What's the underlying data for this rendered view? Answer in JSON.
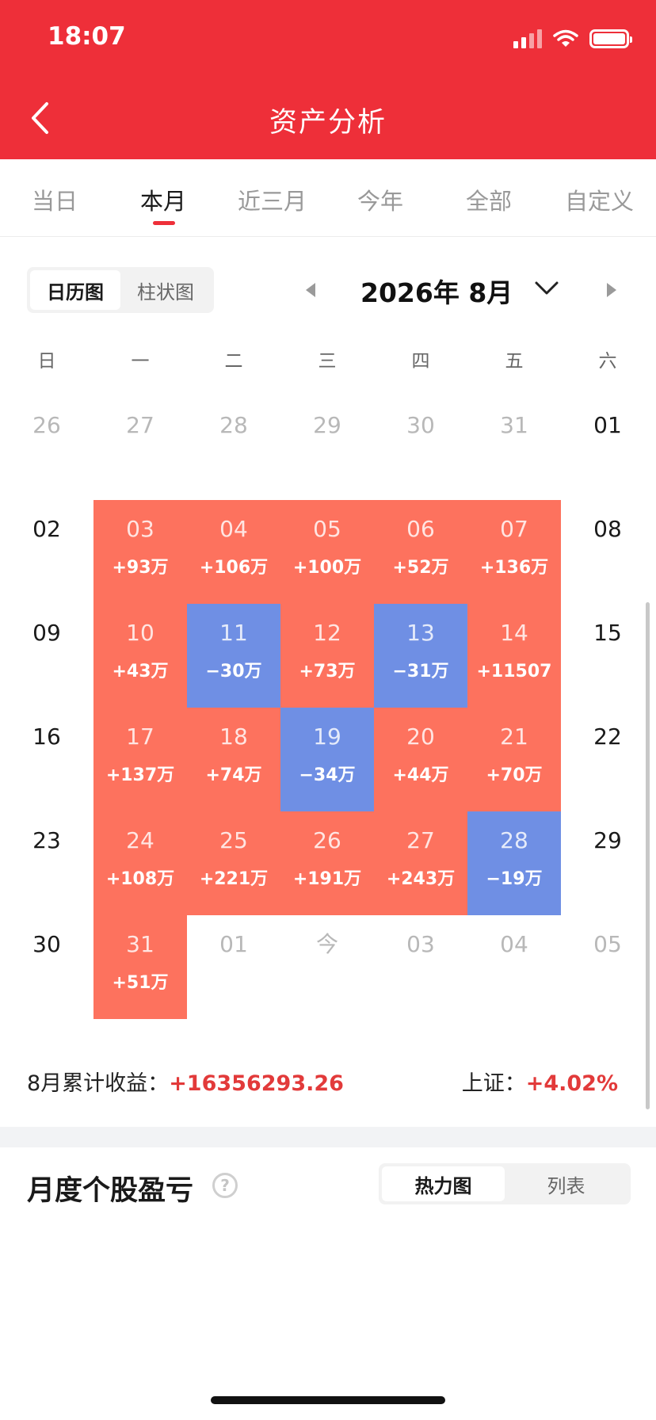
{
  "status_bar": {
    "time": "18:07",
    "signal_bars": 2,
    "battery_level": 1.0
  },
  "header": {
    "title": "资产分析",
    "back_icon": "chevron-left-icon"
  },
  "period_tabs": [
    {
      "label": "当日",
      "active": false
    },
    {
      "label": "本月",
      "active": true
    },
    {
      "label": "近三月",
      "active": false
    },
    {
      "label": "今年",
      "active": false
    },
    {
      "label": "全部",
      "active": false
    },
    {
      "label": "自定义",
      "active": false
    }
  ],
  "view_toggle": [
    {
      "label": "日历图",
      "active": true
    },
    {
      "label": "柱状图",
      "active": false
    }
  ],
  "month_nav": {
    "label": "2026年 8月",
    "prev_icon": "triangle-left-icon",
    "dropdown_icon": "chevron-down-icon",
    "next_icon": "triangle-right-icon"
  },
  "weekdays": [
    "日",
    "一",
    "二",
    "三",
    "四",
    "五",
    "六"
  ],
  "calendar": [
    [
      {
        "d": "26",
        "s": "muted"
      },
      {
        "d": "27",
        "s": "muted"
      },
      {
        "d": "28",
        "s": "muted"
      },
      {
        "d": "29",
        "s": "muted"
      },
      {
        "d": "30",
        "s": "muted"
      },
      {
        "d": "31",
        "s": "muted"
      },
      {
        "d": "01",
        "s": "plain"
      }
    ],
    [
      {
        "d": "02",
        "s": "plain"
      },
      {
        "d": "03",
        "v": "+93万",
        "s": "up"
      },
      {
        "d": "04",
        "v": "+106万",
        "s": "up"
      },
      {
        "d": "05",
        "v": "+100万",
        "s": "up"
      },
      {
        "d": "06",
        "v": "+52万",
        "s": "up"
      },
      {
        "d": "07",
        "v": "+136万",
        "s": "up"
      },
      {
        "d": "08",
        "s": "plain"
      }
    ],
    [
      {
        "d": "09",
        "s": "plain"
      },
      {
        "d": "10",
        "v": "+43万",
        "s": "up"
      },
      {
        "d": "11",
        "v": "−30万",
        "s": "down"
      },
      {
        "d": "12",
        "v": "+73万",
        "s": "up"
      },
      {
        "d": "13",
        "v": "−31万",
        "s": "down"
      },
      {
        "d": "14",
        "v": "+11507",
        "s": "up"
      },
      {
        "d": "15",
        "s": "plain"
      }
    ],
    [
      {
        "d": "16",
        "s": "plain"
      },
      {
        "d": "17",
        "v": "+137万",
        "s": "up"
      },
      {
        "d": "18",
        "v": "+74万",
        "s": "up"
      },
      {
        "d": "19",
        "v": "−34万",
        "s": "down"
      },
      {
        "d": "20",
        "v": "+44万",
        "s": "up"
      },
      {
        "d": "21",
        "v": "+70万",
        "s": "up"
      },
      {
        "d": "22",
        "s": "plain"
      }
    ],
    [
      {
        "d": "23",
        "s": "plain"
      },
      {
        "d": "24",
        "v": "+108万",
        "s": "up"
      },
      {
        "d": "25",
        "v": "+221万",
        "s": "up"
      },
      {
        "d": "26",
        "v": "+191万",
        "s": "up"
      },
      {
        "d": "27",
        "v": "+243万",
        "s": "up"
      },
      {
        "d": "28",
        "v": "−19万",
        "s": "down"
      },
      {
        "d": "29",
        "s": "plain"
      }
    ],
    [
      {
        "d": "30",
        "s": "plain"
      },
      {
        "d": "31",
        "v": "+51万",
        "s": "up"
      },
      {
        "d": "01",
        "s": "muted"
      },
      {
        "d": "今",
        "s": "muted"
      },
      {
        "d": "03",
        "s": "muted"
      },
      {
        "d": "04",
        "s": "muted"
      },
      {
        "d": "05",
        "s": "muted"
      }
    ]
  ],
  "colors": {
    "brand_red": "#ee2f39",
    "gain": "#fd725e",
    "loss": "#6f8fe4",
    "gain_text": "#e23a3a"
  },
  "summary": {
    "label": "8月累计收益：",
    "value": "+16356293.26",
    "index_label": "上证：",
    "index_value": "+4.02%"
  },
  "monthly_stocks": {
    "title": "月度个股盈亏",
    "help_icon": "question-circle-icon",
    "toggle": [
      {
        "label": "热力图",
        "active": true
      },
      {
        "label": "列表",
        "active": false
      }
    ]
  }
}
